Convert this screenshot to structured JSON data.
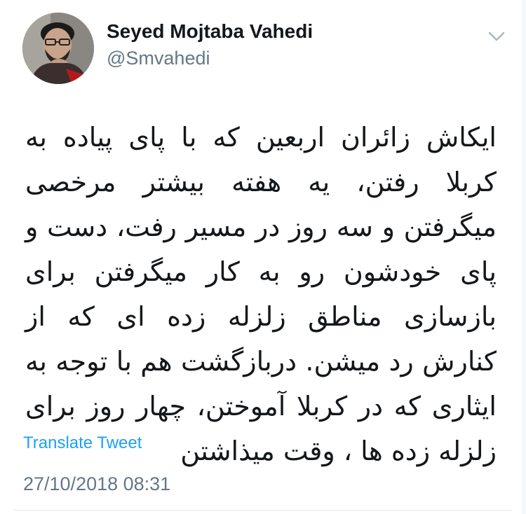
{
  "tweet": {
    "author": {
      "display_name": "Seyed Mojtaba Vahedi",
      "handle": "@Smvahedi",
      "avatar_icon": "profile-photo"
    },
    "menu_icon": "chevron-down-icon",
    "text": "ایکاش زائران اربعین که با پای پیاده به کربلا رفتن، یه هفته بیشتر مرخصی میگرفتن و سه روز در مسیر رفت، دست و پای خودشون رو به کار میگرفتن برای بازسازی مناطق زلزله زده ای که از کنارش رد میشن. دربازگشت هم با توجه به ایثاری که در کربلا آموختن،  چهار روز برای زلزله زده ها ، وقت میذاشتن",
    "translate_label": "Translate Tweet",
    "timestamp": "27/10/2018 08:31"
  },
  "colors": {
    "text": "#14171a",
    "secondary": "#657786",
    "link": "#1da1f2",
    "divider": "#e1e8ed"
  }
}
